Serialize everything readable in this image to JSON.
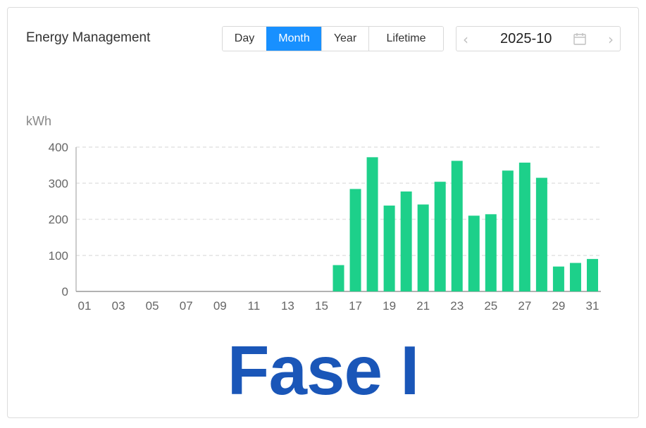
{
  "header": {
    "title": "Energy Management",
    "tabs": [
      "Day",
      "Month",
      "Year",
      "Lifetime"
    ],
    "active_tab": "Month"
  },
  "date_picker": {
    "value": "2025-10",
    "prev_icon": "chevron-left-icon",
    "next_icon": "chevron-right-icon",
    "calendar_icon": "calendar-icon"
  },
  "overlay": {
    "text": "Fase I"
  },
  "colors": {
    "accent": "#1890ff",
    "bar": "#1dd08a",
    "overlay": "#1a56b8"
  },
  "chart_data": {
    "type": "bar",
    "ylabel": "kWh",
    "ylim": [
      0,
      400
    ],
    "yticks": [
      0,
      100,
      200,
      300,
      400
    ],
    "grid": true,
    "categories": [
      "01",
      "02",
      "03",
      "04",
      "05",
      "06",
      "07",
      "08",
      "09",
      "10",
      "11",
      "12",
      "13",
      "14",
      "15",
      "16",
      "17",
      "18",
      "19",
      "20",
      "21",
      "22",
      "23",
      "24",
      "25",
      "26",
      "27",
      "28",
      "29",
      "30",
      "31"
    ],
    "xtick_labels": [
      "01",
      "03",
      "05",
      "07",
      "09",
      "11",
      "13",
      "15",
      "17",
      "19",
      "21",
      "23",
      "25",
      "27",
      "29",
      "31"
    ],
    "values": [
      0,
      0,
      0,
      0,
      0,
      0,
      0,
      0,
      0,
      0,
      0,
      0,
      0,
      0,
      0,
      73,
      284,
      372,
      238,
      277,
      241,
      304,
      362,
      210,
      214,
      335,
      357,
      315,
      69,
      79,
      90
    ]
  }
}
